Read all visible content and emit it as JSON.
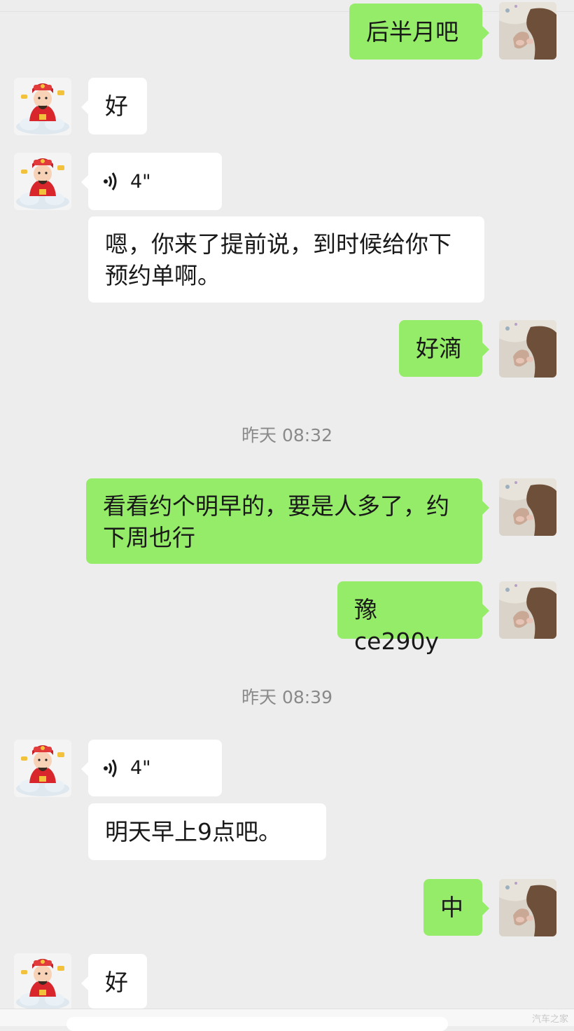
{
  "colors": {
    "background": "#ededed",
    "self_bubble": "#95ec69",
    "other_bubble": "#ffffff",
    "time_text": "#8a8a8a"
  },
  "icons": {
    "voice": "voice-wave-icon",
    "self_avatar": "self-avatar-photo",
    "other_avatar": "caishen-avatar"
  },
  "messages": [
    {
      "sender": "self",
      "text": "后半月吧"
    },
    {
      "sender": "other",
      "text": "好"
    },
    {
      "sender": "other",
      "type": "voice",
      "duration": "4\""
    },
    {
      "sender": "other",
      "text": "嗯，你来了提前说，到时候给你下预约单啊。"
    },
    {
      "sender": "self",
      "text": "好滴"
    },
    {
      "type": "time",
      "text": "昨天 08:32"
    },
    {
      "sender": "self",
      "text": "看看约个明早的，要是人多了，约下周也行"
    },
    {
      "sender": "self",
      "text": "豫 ce290y"
    },
    {
      "type": "time",
      "text": "昨天 08:39"
    },
    {
      "sender": "other",
      "type": "voice",
      "duration": "4\""
    },
    {
      "sender": "other",
      "text": "明天早上9点吧。"
    },
    {
      "sender": "self",
      "text": "中"
    },
    {
      "sender": "other",
      "text": "好"
    }
  ],
  "watermark": "汽车之家"
}
